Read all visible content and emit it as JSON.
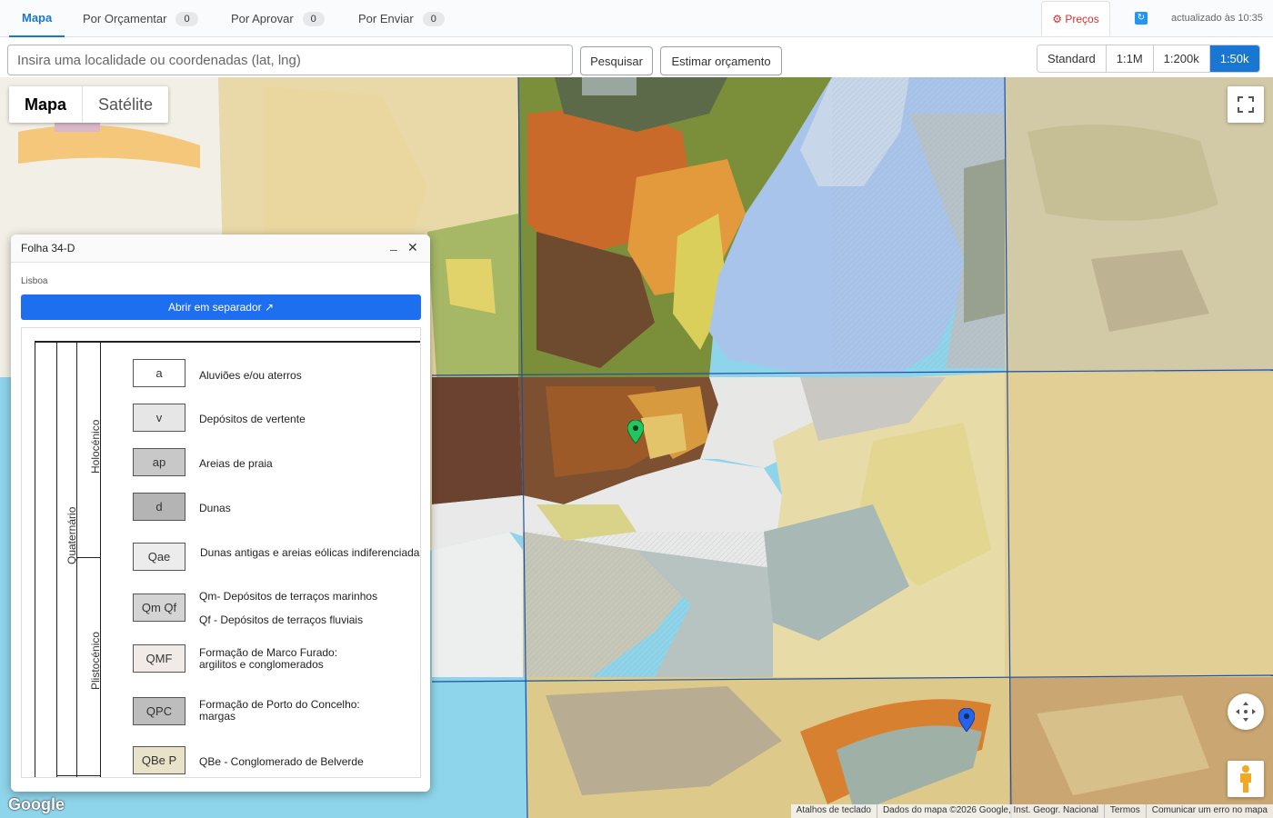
{
  "topbar": {
    "tabs": [
      {
        "label": "Mapa",
        "badge": null
      },
      {
        "label": "Por Orçamentar",
        "badge": "0"
      },
      {
        "label": "Por Aprovar",
        "badge": "0"
      },
      {
        "label": "Por Enviar",
        "badge": "0"
      }
    ],
    "prices_label": "⚙ Preços",
    "refresh_icon": "↻",
    "updated": "actualizado às 10:35"
  },
  "search": {
    "placeholder": "Insira uma localidade ou coordenadas (lat, lng)",
    "search_button": "Pesquisar",
    "estimate_button": "Estimar orçamento"
  },
  "scales": {
    "options": [
      "Standard",
      "1:1M",
      "1:200k",
      "1:50k"
    ],
    "selected": "1:50k"
  },
  "map": {
    "map_types": [
      "Mapa",
      "Satélite"
    ],
    "selected_type": "Mapa",
    "google_logo": "Google",
    "attribution": [
      "Atalhos de teclado",
      "Dados do mapa ©2026 Google, Inst. Geogr. Nacional",
      "Termos",
      "Comunicar um erro no mapa"
    ],
    "markers": [
      {
        "color": "#22c55e"
      },
      {
        "color": "#2563eb"
      }
    ]
  },
  "panel": {
    "title": "Folha 34-D",
    "minimize_icon": "–",
    "close_icon": "✕",
    "location": "Lisboa",
    "open_button": "Abrir em separador ↗",
    "legend": {
      "era": "Quaternário",
      "epoch_upper": "Holocénico",
      "epoch_lower": "Plistocénico",
      "items": [
        {
          "code": "a",
          "text": "Aluviões e/ou aterros"
        },
        {
          "code": "v",
          "text": "Depósitos de vertente"
        },
        {
          "code": "ap",
          "text": "Areias de praia"
        },
        {
          "code": "d",
          "text": "Dunas"
        },
        {
          "code": "Qae",
          "text": "Dunas antigas e areias eólicas indiferenciadas"
        },
        {
          "code": "Qm Qf",
          "text": "Qm- Depósitos de terraços marinhos",
          "text2": "Qf - Depósitos de terraços fluviais"
        },
        {
          "code": "QMF",
          "text": "Formação de Marco Furado:",
          "text2": "argilitos e conglomerados"
        },
        {
          "code": "QPC",
          "text": "Formação de Porto do Concelho:",
          "text2": "margas"
        },
        {
          "code": "QBe P",
          "text": "QBe - Conglomerado de Belverde"
        }
      ]
    }
  }
}
